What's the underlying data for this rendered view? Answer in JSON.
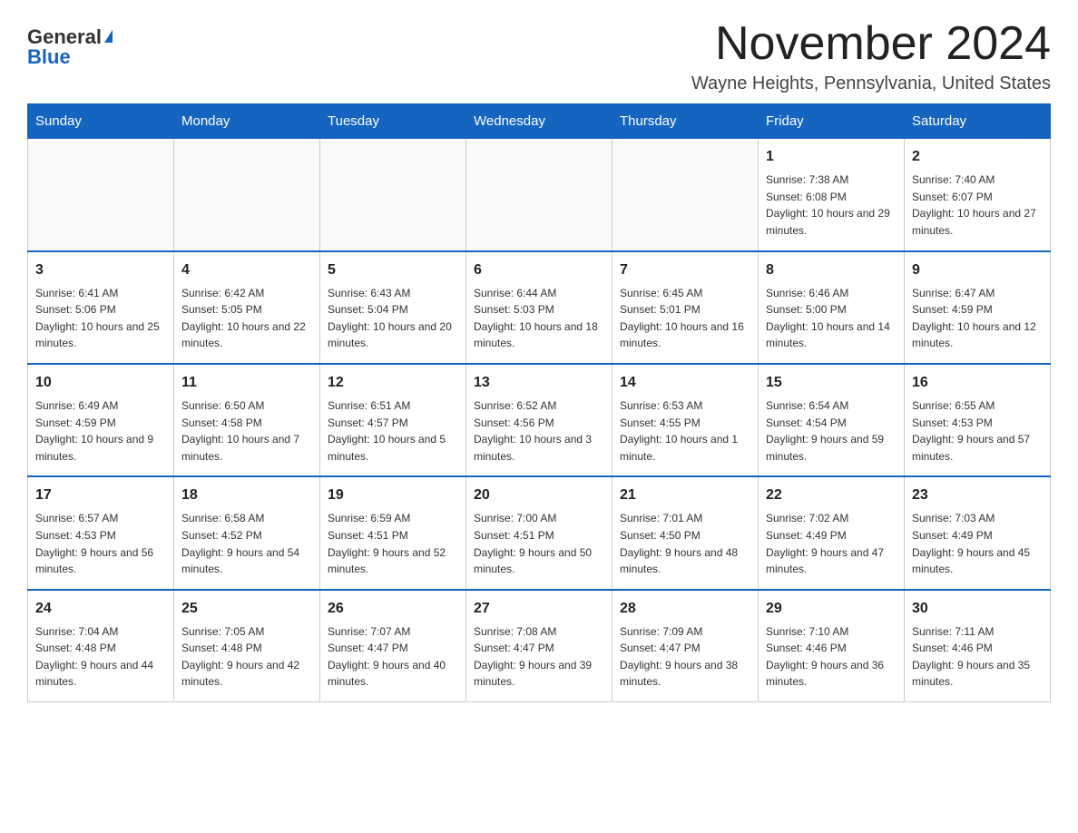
{
  "header": {
    "logo_general": "General",
    "logo_blue": "Blue",
    "month_title": "November 2024",
    "location": "Wayne Heights, Pennsylvania, United States"
  },
  "weekdays": [
    "Sunday",
    "Monday",
    "Tuesday",
    "Wednesday",
    "Thursday",
    "Friday",
    "Saturday"
  ],
  "weeks": [
    [
      {
        "day": "",
        "info": ""
      },
      {
        "day": "",
        "info": ""
      },
      {
        "day": "",
        "info": ""
      },
      {
        "day": "",
        "info": ""
      },
      {
        "day": "",
        "info": ""
      },
      {
        "day": "1",
        "info": "Sunrise: 7:38 AM\nSunset: 6:08 PM\nDaylight: 10 hours and 29 minutes."
      },
      {
        "day": "2",
        "info": "Sunrise: 7:40 AM\nSunset: 6:07 PM\nDaylight: 10 hours and 27 minutes."
      }
    ],
    [
      {
        "day": "3",
        "info": "Sunrise: 6:41 AM\nSunset: 5:06 PM\nDaylight: 10 hours and 25 minutes."
      },
      {
        "day": "4",
        "info": "Sunrise: 6:42 AM\nSunset: 5:05 PM\nDaylight: 10 hours and 22 minutes."
      },
      {
        "day": "5",
        "info": "Sunrise: 6:43 AM\nSunset: 5:04 PM\nDaylight: 10 hours and 20 minutes."
      },
      {
        "day": "6",
        "info": "Sunrise: 6:44 AM\nSunset: 5:03 PM\nDaylight: 10 hours and 18 minutes."
      },
      {
        "day": "7",
        "info": "Sunrise: 6:45 AM\nSunset: 5:01 PM\nDaylight: 10 hours and 16 minutes."
      },
      {
        "day": "8",
        "info": "Sunrise: 6:46 AM\nSunset: 5:00 PM\nDaylight: 10 hours and 14 minutes."
      },
      {
        "day": "9",
        "info": "Sunrise: 6:47 AM\nSunset: 4:59 PM\nDaylight: 10 hours and 12 minutes."
      }
    ],
    [
      {
        "day": "10",
        "info": "Sunrise: 6:49 AM\nSunset: 4:59 PM\nDaylight: 10 hours and 9 minutes."
      },
      {
        "day": "11",
        "info": "Sunrise: 6:50 AM\nSunset: 4:58 PM\nDaylight: 10 hours and 7 minutes."
      },
      {
        "day": "12",
        "info": "Sunrise: 6:51 AM\nSunset: 4:57 PM\nDaylight: 10 hours and 5 minutes."
      },
      {
        "day": "13",
        "info": "Sunrise: 6:52 AM\nSunset: 4:56 PM\nDaylight: 10 hours and 3 minutes."
      },
      {
        "day": "14",
        "info": "Sunrise: 6:53 AM\nSunset: 4:55 PM\nDaylight: 10 hours and 1 minute."
      },
      {
        "day": "15",
        "info": "Sunrise: 6:54 AM\nSunset: 4:54 PM\nDaylight: 9 hours and 59 minutes."
      },
      {
        "day": "16",
        "info": "Sunrise: 6:55 AM\nSunset: 4:53 PM\nDaylight: 9 hours and 57 minutes."
      }
    ],
    [
      {
        "day": "17",
        "info": "Sunrise: 6:57 AM\nSunset: 4:53 PM\nDaylight: 9 hours and 56 minutes."
      },
      {
        "day": "18",
        "info": "Sunrise: 6:58 AM\nSunset: 4:52 PM\nDaylight: 9 hours and 54 minutes."
      },
      {
        "day": "19",
        "info": "Sunrise: 6:59 AM\nSunset: 4:51 PM\nDaylight: 9 hours and 52 minutes."
      },
      {
        "day": "20",
        "info": "Sunrise: 7:00 AM\nSunset: 4:51 PM\nDaylight: 9 hours and 50 minutes."
      },
      {
        "day": "21",
        "info": "Sunrise: 7:01 AM\nSunset: 4:50 PM\nDaylight: 9 hours and 48 minutes."
      },
      {
        "day": "22",
        "info": "Sunrise: 7:02 AM\nSunset: 4:49 PM\nDaylight: 9 hours and 47 minutes."
      },
      {
        "day": "23",
        "info": "Sunrise: 7:03 AM\nSunset: 4:49 PM\nDaylight: 9 hours and 45 minutes."
      }
    ],
    [
      {
        "day": "24",
        "info": "Sunrise: 7:04 AM\nSunset: 4:48 PM\nDaylight: 9 hours and 44 minutes."
      },
      {
        "day": "25",
        "info": "Sunrise: 7:05 AM\nSunset: 4:48 PM\nDaylight: 9 hours and 42 minutes."
      },
      {
        "day": "26",
        "info": "Sunrise: 7:07 AM\nSunset: 4:47 PM\nDaylight: 9 hours and 40 minutes."
      },
      {
        "day": "27",
        "info": "Sunrise: 7:08 AM\nSunset: 4:47 PM\nDaylight: 9 hours and 39 minutes."
      },
      {
        "day": "28",
        "info": "Sunrise: 7:09 AM\nSunset: 4:47 PM\nDaylight: 9 hours and 38 minutes."
      },
      {
        "day": "29",
        "info": "Sunrise: 7:10 AM\nSunset: 4:46 PM\nDaylight: 9 hours and 36 minutes."
      },
      {
        "day": "30",
        "info": "Sunrise: 7:11 AM\nSunset: 4:46 PM\nDaylight: 9 hours and 35 minutes."
      }
    ]
  ]
}
